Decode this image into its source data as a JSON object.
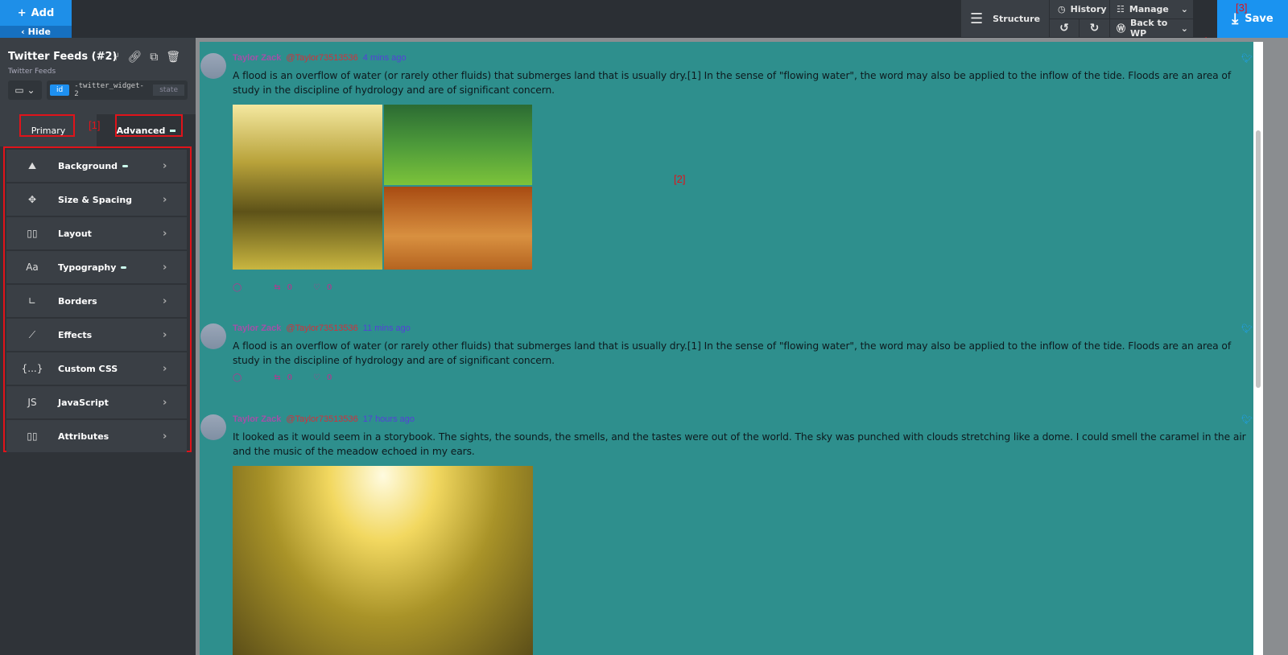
{
  "topbar": {
    "add": "Add",
    "hide": "Hide",
    "structure": "Structure",
    "history": "History",
    "manage": "Manage",
    "back_to_wp": "Back to WP",
    "save": "Save",
    "annotation": "[3]"
  },
  "element": {
    "title": "Twitter Feeds (#2)",
    "subtitle": "Twitter Feeds",
    "id_label": "id",
    "id_value": "-twitter_widget-2",
    "state": "state"
  },
  "tabs": {
    "primary": "Primary",
    "advanced": "Advanced",
    "annotation": "[1]"
  },
  "panels": [
    {
      "label": "Background",
      "icon": "image-icon",
      "dot": true
    },
    {
      "label": "Size & Spacing",
      "icon": "move-icon",
      "dot": false
    },
    {
      "label": "Layout",
      "icon": "layout-icon",
      "dot": false
    },
    {
      "label": "Typography",
      "icon": "Aa",
      "dot": true
    },
    {
      "label": "Borders",
      "icon": "border-icon",
      "dot": false
    },
    {
      "label": "Effects",
      "icon": "wand-icon",
      "dot": false
    },
    {
      "label": "Custom CSS",
      "icon": "{...}",
      "dot": false
    },
    {
      "label": "JavaScript",
      "icon": "JS",
      "dot": false
    },
    {
      "label": "Attributes",
      "icon": "attributes-icon",
      "dot": false
    }
  ],
  "canvas_annotation": "[2]",
  "colors": {
    "feed_bg": "#2e8f8d",
    "accent": "#1a93f0",
    "name": "#a54fa8",
    "handle": "#d3303a",
    "time": "#5540d8"
  },
  "tweets": [
    {
      "name": "Taylor Zack",
      "handle": "@Taylor73513536",
      "time": "4 mins ago",
      "text": "A flood is an overflow of water (or rarely other fluids) that submerges land that is usually dry.[1] In the sense of \"flowing water\", the word may also be applied to the inflow of the tide. Floods are an area of study in the discipline of hydrology and are of significant concern.",
      "retweets": "0",
      "likes": "0"
    },
    {
      "name": "Taylor Zack",
      "handle": "@Taylor73513536",
      "time": "11 mins ago",
      "text": "A flood is an overflow of water (or rarely other fluids) that submerges land that is usually dry.[1] In the sense of \"flowing water\", the word may also be applied to the inflow of the tide. Floods are an area of study in the discipline of hydrology and are of significant concern.",
      "retweets": "0",
      "likes": "0"
    },
    {
      "name": "Taylor Zack",
      "handle": "@Taylor73513536",
      "time": "17 hours ago",
      "text": "It looked as it would seem in a storybook. The sights, the sounds, the smells, and the tastes were out of the world. The sky was punched with clouds stretching like a dome. I could smell the caramel in the air and the music of the meadow echoed in my ears."
    }
  ]
}
